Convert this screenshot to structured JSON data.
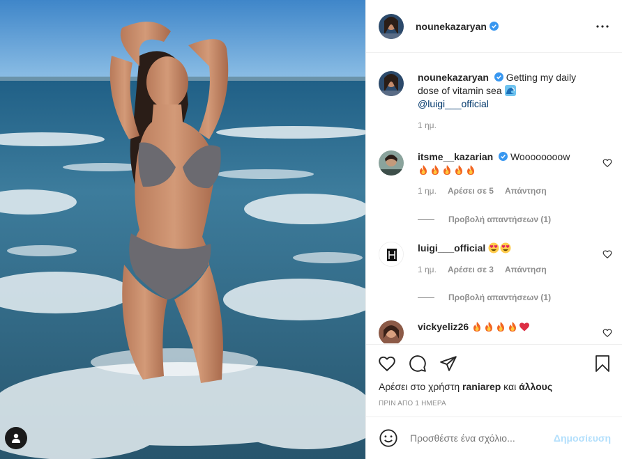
{
  "post": {
    "author": "nounekazaryan",
    "verified": true,
    "more_icon": "more-horizontal-icon"
  },
  "caption": {
    "author": "nounekazaryan",
    "text": "Getting my daily dose of vitamin sea",
    "emoji": "wave-emoji",
    "mention": "@luigi___official",
    "time": "1 ημ."
  },
  "comments": [
    {
      "user": "itsme__kazarian",
      "verified": true,
      "text": "Woooooooow",
      "emojis": [
        "fire",
        "fire",
        "fire",
        "fire",
        "fire"
      ],
      "time": "1 ημ.",
      "likes_label": "Αρέσει σε 5",
      "reply_label": "Απάντηση",
      "view_replies": "Προβολή απαντήσεων (1)"
    },
    {
      "user": "luigi___official",
      "verified": false,
      "text": "",
      "emojis": [
        "heart-eyes",
        "heart-eyes"
      ],
      "time": "1 ημ.",
      "likes_label": "Αρέσει σε 3",
      "reply_label": "Απάντηση",
      "view_replies": "Προβολή απαντήσεων (1)"
    },
    {
      "user": "vickyeliz26",
      "verified": false,
      "text": "",
      "emojis": [
        "fire",
        "fire",
        "fire",
        "fire",
        "red-heart"
      ]
    }
  ],
  "actions": {
    "like_icon": "heart-icon",
    "comment_icon": "comment-icon",
    "share_icon": "paper-plane-icon",
    "save_icon": "bookmark-icon",
    "likes_prefix": "Αρέσει στο χρήστη",
    "likes_user": "raniarep",
    "likes_and": "και",
    "likes_others": "άλλους",
    "date": "ΠΡΙΝ ΑΠΟ 1 ΗΜΕΡΑ"
  },
  "add_comment": {
    "placeholder": "Προσθέστε ένα σχόλιο...",
    "post_label": "Δημοσίευση"
  },
  "colors": {
    "link": "#00376b",
    "muted": "#8e8e8e",
    "post_disabled": "#b2dffc",
    "verified": "#3897f0"
  }
}
